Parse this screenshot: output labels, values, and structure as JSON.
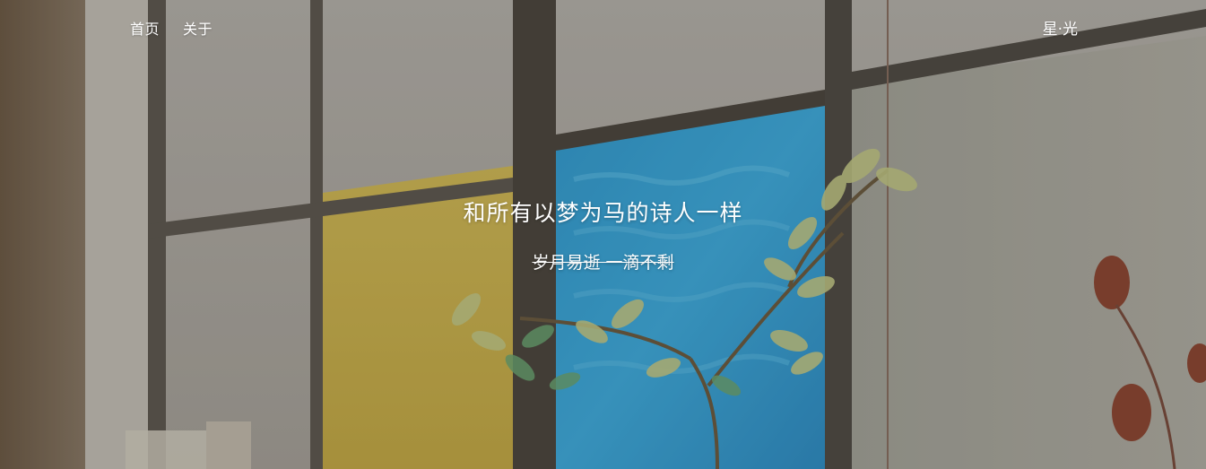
{
  "nav": {
    "items": [
      {
        "label": "首页"
      },
      {
        "label": "关于"
      }
    ]
  },
  "brand": {
    "label": "星·光"
  },
  "hero": {
    "title": "和所有以梦为马的诗人一样",
    "subtitle": "岁月易逝 一滴不剩",
    "background": "window-plant-photo"
  }
}
